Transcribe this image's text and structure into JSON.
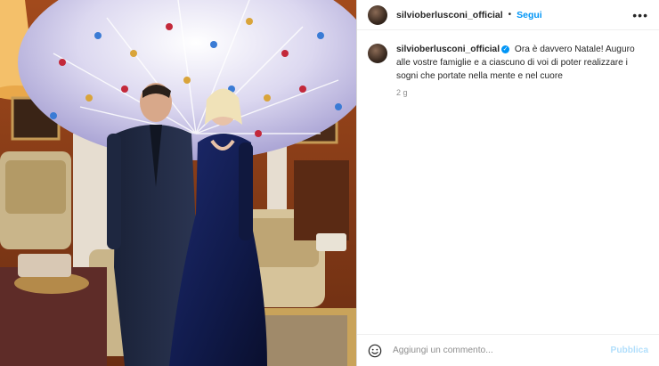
{
  "post": {
    "username": "silvioberlusconi_official",
    "separator": "•",
    "follow_label": "Segui",
    "more_label": "•••",
    "caption_username": "silvioberlusconi_official",
    "verified_mark": "✓",
    "caption_text": "Ora è davvero Natale! Auguro alle vostre famiglie e a ciascuno di voi di poter realizzare i sogni che portate nella mente e nel cuore",
    "timestamp": "2 g",
    "comment_placeholder": "Aggiungi un commento...",
    "publish_label": "Pubblica"
  },
  "icons": {
    "avatar": "profile-avatar",
    "verified": "verified-badge-icon",
    "more": "more-options-icon",
    "emoji": "emoji-icon"
  },
  "colors": {
    "accent": "#0095f6",
    "publish_disabled": "#b2dffc",
    "text": "#262626",
    "muted": "#8e8e8e",
    "border": "#dbdbdb"
  }
}
